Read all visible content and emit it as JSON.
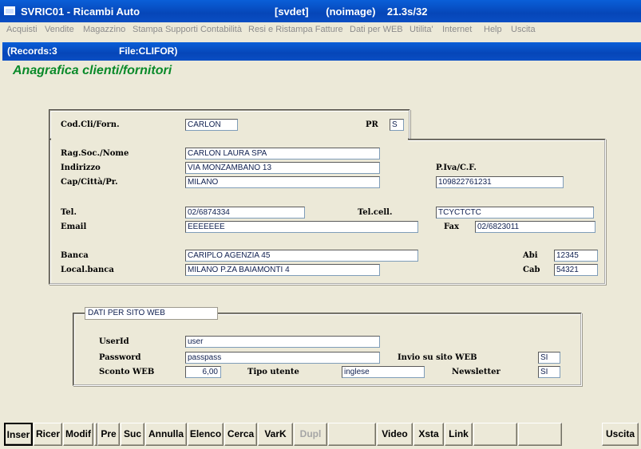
{
  "window": {
    "title": "SVRIC01 - Ricambi Auto",
    "subtitle": "[svdet]      (noimage)    21.3s/32"
  },
  "menu": [
    "Acquisti",
    "Vendite",
    "Magazzino",
    "Stampa Supporti Contabilità",
    "Resi e Ristampa Fatture",
    "Dati per WEB",
    "Utilita'",
    "Internet",
    "Help",
    "Uscita"
  ],
  "infobar": {
    "records": "(Records:3",
    "file": "File:CLIFOR)"
  },
  "form": {
    "title": "Anagrafica clienti/fornitori",
    "cod_label": "Cod.Cli/Forn.",
    "cod_value": "CARLON",
    "pr_label": "PR",
    "pr_value": "S",
    "ragsoc_label": "Rag.Soc./Nome",
    "ragsoc_value": "CARLON LAURA SPA",
    "indirizzo_label": "Indirizzo",
    "indirizzo_value": "VIA MONZAMBANO 13",
    "piva_label": "P.Iva/C.F.",
    "cap_label": "Cap/Città/Pr.",
    "cap_value": "MILANO",
    "piva_value": "109822761231",
    "tel_label": "Tel.",
    "tel_value": "02/6874334",
    "telcell_label": "Tel.cell.",
    "telcell_value": "TCYCTCTC",
    "email_label": "Email",
    "email_value": "EEEEEEE",
    "fax_label": "Fax",
    "fax_value": "02/6823011",
    "banca_label": "Banca",
    "banca_value": "CARIPLO AGENZIA 45",
    "abi_label": "Abi",
    "abi_value": "12345",
    "localbanca_label": "Local.banca",
    "localbanca_value": "MILANO P.ZA BAIAMONTI 4",
    "cab_label": "Cab",
    "cab_value": "54321"
  },
  "web": {
    "legend": "DATI PER SITO WEB",
    "userid_label": "UserId",
    "userid_value": "user",
    "password_label": "Password",
    "password_value": "passpass",
    "invio_label": "Invio su sito WEB",
    "invio_value": "SI",
    "sconto_label": "Sconto WEB",
    "sconto_value": "6,00",
    "tipo_label": "Tipo utente",
    "tipo_value": "inglese",
    "newsletter_label": "Newsletter",
    "newsletter_value": "SI"
  },
  "toolbar": [
    "Inser",
    "Ricer",
    "Modif",
    "Pre",
    "Suc",
    "Annulla",
    "Elenco",
    "Cerca",
    "VarK",
    "Dupl",
    "Video",
    "Xsta",
    "Link",
    "Uscita"
  ],
  "colors": {
    "title_bar": "#0a5fd8",
    "form_title": "#0a8a2a",
    "background": "#ece9d8"
  }
}
